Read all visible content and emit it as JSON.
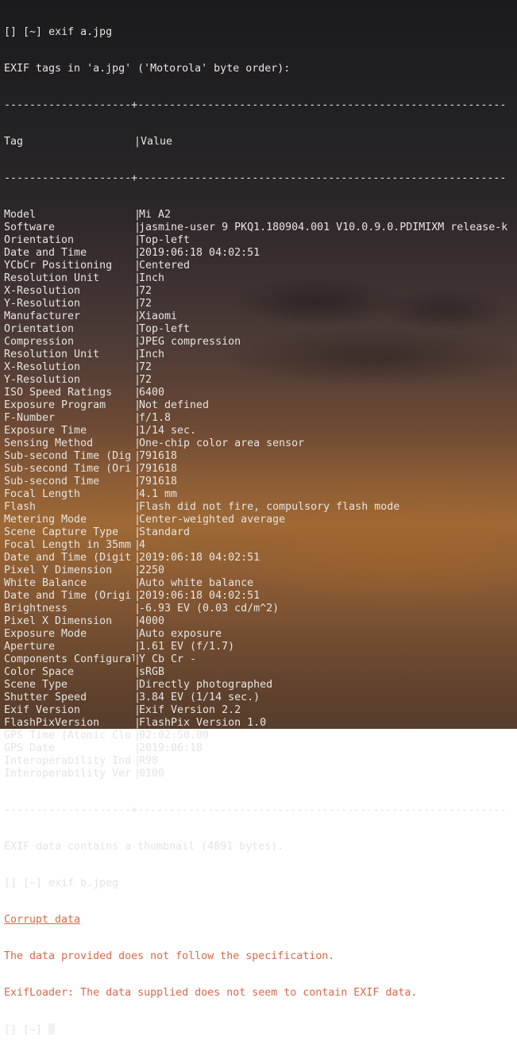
{
  "terminal": {
    "prompt": "[] [~]",
    "command1": "exif a.jpg",
    "header": "EXIF tags in 'a.jpg' ('Motorola' byte order):",
    "rule": "--------------------+----------------------------------------------------------",
    "columns": {
      "tag": "Tag",
      "value": "|Value"
    },
    "separator": "|",
    "rows": [
      {
        "tag": "Model",
        "value": "Mi A2"
      },
      {
        "tag": "Software",
        "value": "jasmine-user 9 PKQ1.180904.001 V10.0.9.0.PDIMIXM release-k"
      },
      {
        "tag": "Orientation",
        "value": "Top-left"
      },
      {
        "tag": "Date and Time",
        "value": "2019:06:18 04:02:51"
      },
      {
        "tag": "YCbCr Positioning",
        "value": "Centered"
      },
      {
        "tag": "Resolution Unit",
        "value": "Inch"
      },
      {
        "tag": "X-Resolution",
        "value": "72"
      },
      {
        "tag": "Y-Resolution",
        "value": "72"
      },
      {
        "tag": "Manufacturer",
        "value": "Xiaomi"
      },
      {
        "tag": "Orientation",
        "value": "Top-left"
      },
      {
        "tag": "Compression",
        "value": "JPEG compression"
      },
      {
        "tag": "Resolution Unit",
        "value": "Inch"
      },
      {
        "tag": "X-Resolution",
        "value": "72"
      },
      {
        "tag": "Y-Resolution",
        "value": "72"
      },
      {
        "tag": "ISO Speed Ratings",
        "value": "6400"
      },
      {
        "tag": "Exposure Program",
        "value": "Not defined"
      },
      {
        "tag": "F-Number",
        "value": "f/1.8"
      },
      {
        "tag": "Exposure Time",
        "value": "1/14 sec."
      },
      {
        "tag": "Sensing Method",
        "value": "One-chip color area sensor"
      },
      {
        "tag": "Sub-second Time (Dig",
        "value": "791618"
      },
      {
        "tag": "Sub-second Time (Ori",
        "value": "791618"
      },
      {
        "tag": "Sub-second Time",
        "value": "791618"
      },
      {
        "tag": "Focal Length",
        "value": "4.1 mm"
      },
      {
        "tag": "Flash",
        "value": "Flash did not fire, compulsory flash mode"
      },
      {
        "tag": "Metering Mode",
        "value": "Center-weighted average"
      },
      {
        "tag": "Scene Capture Type",
        "value": "Standard"
      },
      {
        "tag": "Focal Length in 35mm",
        "value": "4"
      },
      {
        "tag": "Date and Time (Digit",
        "value": "2019:06:18 04:02:51"
      },
      {
        "tag": "Pixel Y Dimension",
        "value": "2250"
      },
      {
        "tag": "White Balance",
        "value": "Auto white balance"
      },
      {
        "tag": "Date and Time (Origi",
        "value": "2019:06:18 04:02:51"
      },
      {
        "tag": "Brightness",
        "value": "-6.93 EV (0.03 cd/m^2)"
      },
      {
        "tag": "Pixel X Dimension",
        "value": "4000"
      },
      {
        "tag": "Exposure Mode",
        "value": "Auto exposure"
      },
      {
        "tag": "Aperture",
        "value": "1.61 EV (f/1.7)"
      },
      {
        "tag": "Components Configural",
        "value": "Y Cb Cr -"
      },
      {
        "tag": "Color Space",
        "value": "sRGB"
      },
      {
        "tag": "Scene Type",
        "value": "Directly photographed"
      },
      {
        "tag": "Shutter Speed",
        "value": "3.84 EV (1/14 sec.)"
      },
      {
        "tag": "Exif Version",
        "value": "Exif Version 2.2"
      },
      {
        "tag": "FlashPixVersion",
        "value": "FlashPix Version 1.0"
      },
      {
        "tag": "GPS Time (Atomic Clo",
        "value": "02:02:50.00"
      },
      {
        "tag": "GPS Date",
        "value": "2019:06:18"
      },
      {
        "tag": "Interoperability Ind",
        "value": "R98"
      },
      {
        "tag": "Interoperability Ver",
        "value": "0100"
      }
    ],
    "thumbnail_note": "EXIF data contains a thumbnail (4891 bytes).",
    "command2": "exif b.jpeg",
    "error_title": "Corrupt data",
    "error_line1": "The data provided does not follow the specification.",
    "error_line2": "ExifLoader: The data supplied does not seem to contain EXIF data.",
    "colors": {
      "text": "#e6e4e0",
      "error": "#d8694a",
      "cursor": "#f2f2f2"
    }
  }
}
